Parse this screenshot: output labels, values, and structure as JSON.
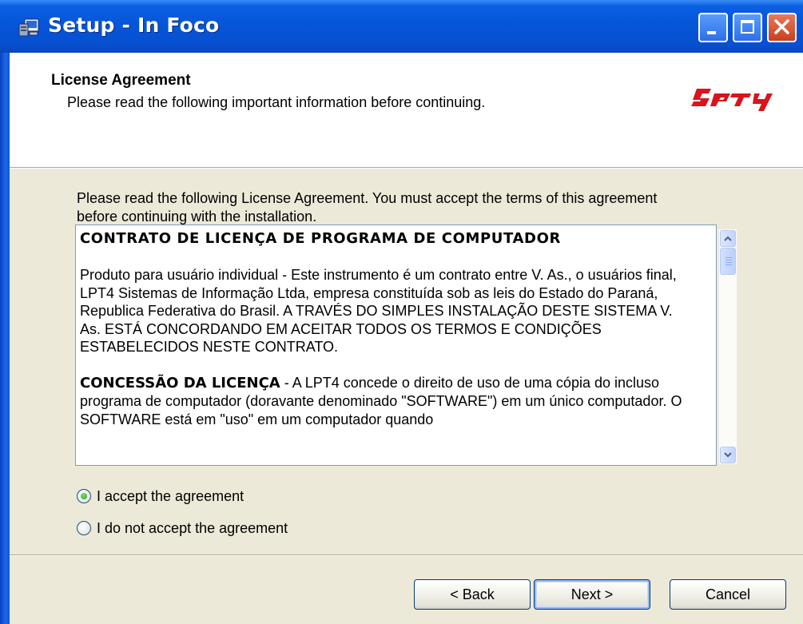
{
  "window": {
    "title": "Setup - In Foco",
    "controls": {
      "minimize": "minimize-icon",
      "maximize": "maximize-icon",
      "close": "close-icon"
    }
  },
  "header": {
    "title": "License Agreement",
    "subtitle": "Please read the following important information before continuing.",
    "logo_text": "lpt4"
  },
  "body": {
    "intro": "Please read the following License Agreement. You must accept the terms of this agreement before continuing with the installation.",
    "license": {
      "heading": "CONTRATO DE LICENÇA DE PROGRAMA DE COMPUTADOR",
      "paragraph1": "Produto para usuário individual - Este instrumento é um contrato entre V.  As., o usuários final, LPT4 Sistemas de Informação Ltda, empresa constituída sob as leis do Estado do Paraná, Republica Federativa do Brasil. A TRAVÉS DO SIMPLES INSTALAÇÃO DESTE SISTEMA V. As. ESTÁ CONCORDANDO EM ACEITAR TODOS OS TERMOS E CONDIÇÕES ESTABELECIDOS NESTE CONTRATO.",
      "paragraph2_title": "CONCESSÃO DA LICENÇA",
      "paragraph2": " - A LPT4 concede o direito  de uso de uma cópia do incluso programa de computador (doravante denominado \"SOFTWARE\") em um único computador. O SOFTWARE está em \"uso\" em um computador quando"
    },
    "options": {
      "accept": "I accept the agreement",
      "decline": "I do not accept the agreement",
      "selected": "accept"
    }
  },
  "buttons": {
    "back": "< Back",
    "next": "Next >",
    "cancel": "Cancel"
  },
  "colors": {
    "titlebar": "#0654d8",
    "dialog_bg": "#ece9d8",
    "logo_red": "#d9141b",
    "close_button": "#c8401f"
  }
}
